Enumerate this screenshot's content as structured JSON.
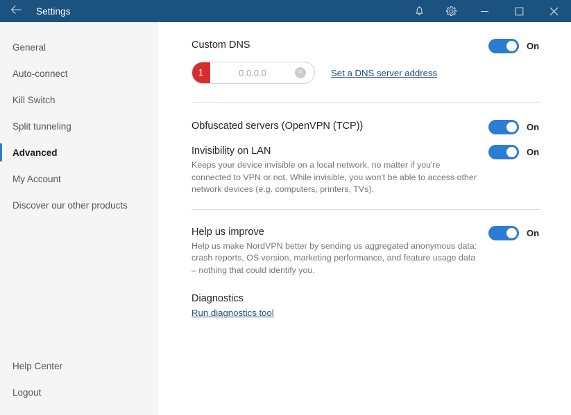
{
  "window": {
    "title": "Settings",
    "back_icon": "back-arrow-icon",
    "notifications_icon": "bell-icon",
    "settings_icon": "gear-icon",
    "minimize_icon": "minimize-icon",
    "maximize_icon": "maximize-icon",
    "close_icon": "close-icon",
    "titlebar_color": "#1b5280"
  },
  "sidebar": {
    "items": [
      {
        "label": "General",
        "active": false
      },
      {
        "label": "Auto-connect",
        "active": false
      },
      {
        "label": "Kill Switch",
        "active": false
      },
      {
        "label": "Split tunneling",
        "active": false
      },
      {
        "label": "Advanced",
        "active": true
      },
      {
        "label": "My Account",
        "active": false
      },
      {
        "label": "Discover our other products",
        "active": false
      }
    ],
    "bottom_items": [
      {
        "label": "Help Center"
      },
      {
        "label": "Logout"
      }
    ],
    "active_accent_color": "#2b7cd3",
    "background_color": "#f5f5f5"
  },
  "settings": {
    "custom_dns": {
      "title": "Custom DNS",
      "toggle_state": "On",
      "dns_index_badge": "1",
      "dns_value": "",
      "dns_placeholder": "0.0.0.0",
      "clear_icon": "clear-circle-icon",
      "clear_glyph": "×",
      "link_label": "Set a DNS server address",
      "badge_color": "#d32f2f"
    },
    "obfuscated_servers": {
      "title": "Obfuscated servers (OpenVPN (TCP))",
      "toggle_state": "On"
    },
    "invisibility_on_lan": {
      "title": "Invisibility on LAN",
      "description": "Keeps your device invisible on a local network, no matter if you're connected to VPN or not. While invisible, you won't be able to access other network devices (e.g. computers, printers, TVs).",
      "toggle_state": "On"
    },
    "help_us_improve": {
      "title": "Help us improve",
      "description": "Help us make NordVPN better by sending us aggregated anonymous data: crash reports, OS version, marketing performance, and feature usage data – nothing that could identify you.",
      "toggle_state": "On"
    },
    "diagnostics": {
      "title": "Diagnostics",
      "link_label": "Run diagnostics tool"
    }
  },
  "theme": {
    "toggle_on_color": "#2b7cd3",
    "link_color": "#1b4f7e",
    "divider_color": "#d8d8d8"
  }
}
